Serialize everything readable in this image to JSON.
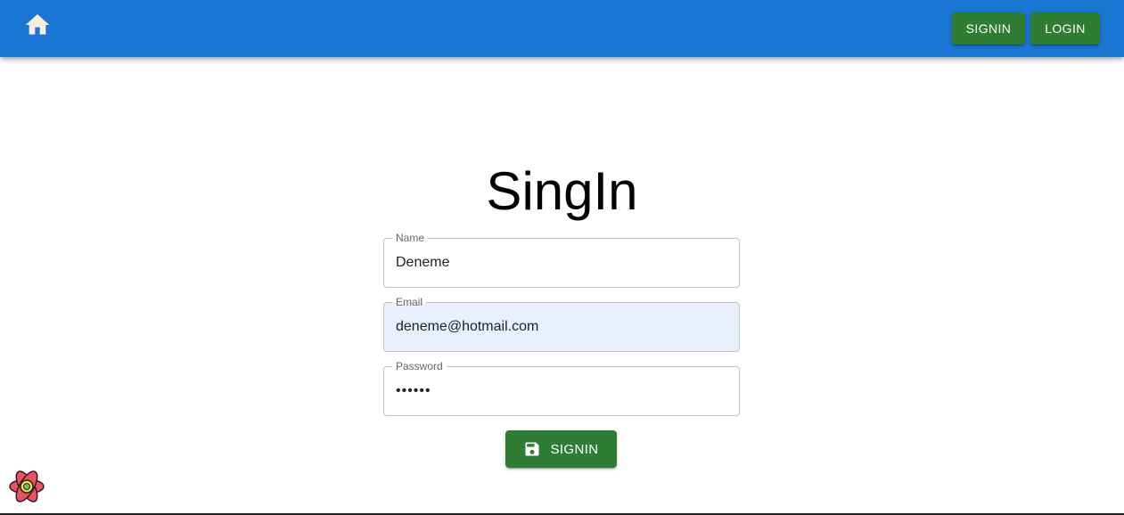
{
  "appbar": {
    "home_icon": "home-icon",
    "nav_buttons": [
      {
        "label": "SIGNIN"
      },
      {
        "label": "LOGIN"
      }
    ],
    "colors": {
      "background": "#1976d2",
      "button": "#2e7d32"
    }
  },
  "form": {
    "title": "SingIn",
    "fields": {
      "name": {
        "label": "Name",
        "value": "Deneme"
      },
      "email": {
        "label": "Email",
        "value": "deneme@hotmail.com"
      },
      "password": {
        "label": "Password",
        "value": "••••••"
      }
    },
    "submit": {
      "label": "SIGNIN",
      "icon": "save-icon"
    }
  },
  "devtools": {
    "icon": "react-query-devtools-icon"
  }
}
